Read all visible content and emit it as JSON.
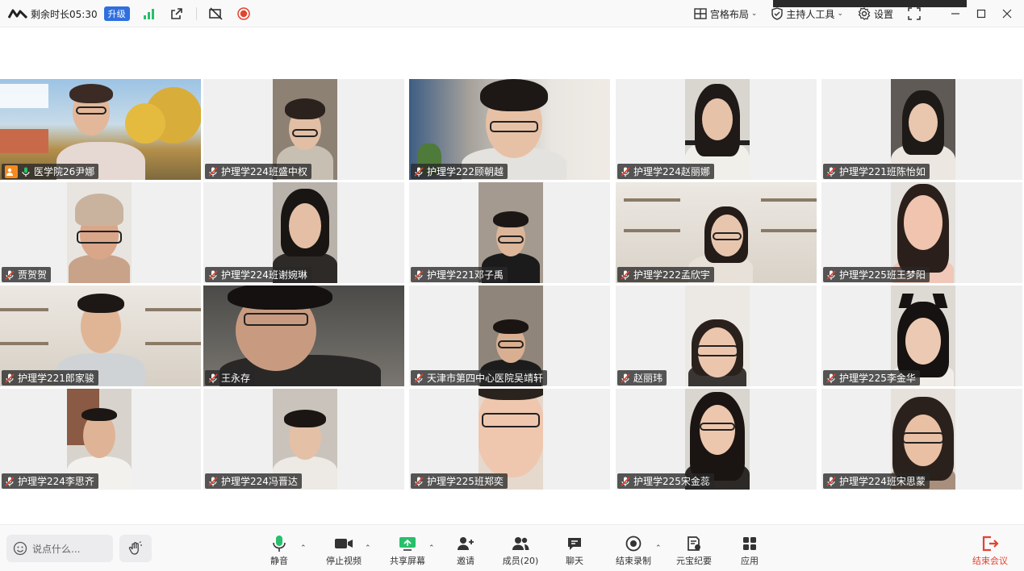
{
  "topbar": {
    "remaining_time": "剩余时长05:30",
    "upgrade_label": "升级",
    "layout_label": "宫格布局",
    "host_tools_label": "主持人工具",
    "settings_label": "设置"
  },
  "participants": [
    {
      "name": "医学院26尹娜",
      "host": true
    },
    {
      "name": "护理学224班盛中权"
    },
    {
      "name": "护理学222顾朝越"
    },
    {
      "name": "护理学224赵丽娜"
    },
    {
      "name": "护理学221班陈怡如"
    },
    {
      "name": "贾贺贺"
    },
    {
      "name": "护理学224班谢婉琳"
    },
    {
      "name": "护理学221邓子禹"
    },
    {
      "name": "护理学222孟欣宇"
    },
    {
      "name": "护理学225班王梦阳"
    },
    {
      "name": "护理学221郎家骏"
    },
    {
      "name": "王永存"
    },
    {
      "name": "天津市第四中心医院吴靖轩"
    },
    {
      "name": "赵丽玮"
    },
    {
      "name": "护理学225李金华"
    },
    {
      "name": "护理学224李思齐"
    },
    {
      "name": "护理学224冯晋达"
    },
    {
      "name": "护理学225班郑奕"
    },
    {
      "name": "护理学225宋金蕊"
    },
    {
      "name": "护理学224班宋思蒙"
    }
  ],
  "bottombar": {
    "chat_placeholder": "说点什么...",
    "mute_label": "静音",
    "stop_video_label": "停止视频",
    "share_label": "共享屏幕",
    "invite_label": "邀请",
    "members_label": "成员(20)",
    "chat_label": "聊天",
    "end_record_label": "结束录制",
    "yuanbao_label": "元宝纪要",
    "apps_label": "应用",
    "end_meeting_label": "结束会议"
  },
  "colors": {
    "accent_blue": "#2f6fde",
    "active_speaker": "#27c06a",
    "end_red": "#e2442f",
    "host_orange": "#f58b1f"
  }
}
